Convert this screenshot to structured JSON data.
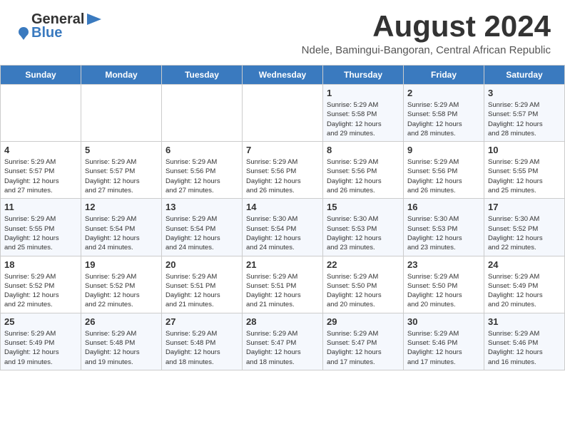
{
  "header": {
    "logo_general": "General",
    "logo_blue": "Blue",
    "month_title": "August 2024",
    "subtitle": "Ndele, Bamingui-Bangoran, Central African Republic"
  },
  "weekdays": [
    "Sunday",
    "Monday",
    "Tuesday",
    "Wednesday",
    "Thursday",
    "Friday",
    "Saturday"
  ],
  "weeks": [
    [
      {
        "day": "",
        "info": ""
      },
      {
        "day": "",
        "info": ""
      },
      {
        "day": "",
        "info": ""
      },
      {
        "day": "",
        "info": ""
      },
      {
        "day": "1",
        "info": "Sunrise: 5:29 AM\nSunset: 5:58 PM\nDaylight: 12 hours\nand 29 minutes."
      },
      {
        "day": "2",
        "info": "Sunrise: 5:29 AM\nSunset: 5:58 PM\nDaylight: 12 hours\nand 28 minutes."
      },
      {
        "day": "3",
        "info": "Sunrise: 5:29 AM\nSunset: 5:57 PM\nDaylight: 12 hours\nand 28 minutes."
      }
    ],
    [
      {
        "day": "4",
        "info": "Sunrise: 5:29 AM\nSunset: 5:57 PM\nDaylight: 12 hours\nand 27 minutes."
      },
      {
        "day": "5",
        "info": "Sunrise: 5:29 AM\nSunset: 5:57 PM\nDaylight: 12 hours\nand 27 minutes."
      },
      {
        "day": "6",
        "info": "Sunrise: 5:29 AM\nSunset: 5:56 PM\nDaylight: 12 hours\nand 27 minutes."
      },
      {
        "day": "7",
        "info": "Sunrise: 5:29 AM\nSunset: 5:56 PM\nDaylight: 12 hours\nand 26 minutes."
      },
      {
        "day": "8",
        "info": "Sunrise: 5:29 AM\nSunset: 5:56 PM\nDaylight: 12 hours\nand 26 minutes."
      },
      {
        "day": "9",
        "info": "Sunrise: 5:29 AM\nSunset: 5:56 PM\nDaylight: 12 hours\nand 26 minutes."
      },
      {
        "day": "10",
        "info": "Sunrise: 5:29 AM\nSunset: 5:55 PM\nDaylight: 12 hours\nand 25 minutes."
      }
    ],
    [
      {
        "day": "11",
        "info": "Sunrise: 5:29 AM\nSunset: 5:55 PM\nDaylight: 12 hours\nand 25 minutes."
      },
      {
        "day": "12",
        "info": "Sunrise: 5:29 AM\nSunset: 5:54 PM\nDaylight: 12 hours\nand 24 minutes."
      },
      {
        "day": "13",
        "info": "Sunrise: 5:29 AM\nSunset: 5:54 PM\nDaylight: 12 hours\nand 24 minutes."
      },
      {
        "day": "14",
        "info": "Sunrise: 5:30 AM\nSunset: 5:54 PM\nDaylight: 12 hours\nand 24 minutes."
      },
      {
        "day": "15",
        "info": "Sunrise: 5:30 AM\nSunset: 5:53 PM\nDaylight: 12 hours\nand 23 minutes."
      },
      {
        "day": "16",
        "info": "Sunrise: 5:30 AM\nSunset: 5:53 PM\nDaylight: 12 hours\nand 23 minutes."
      },
      {
        "day": "17",
        "info": "Sunrise: 5:30 AM\nSunset: 5:52 PM\nDaylight: 12 hours\nand 22 minutes."
      }
    ],
    [
      {
        "day": "18",
        "info": "Sunrise: 5:29 AM\nSunset: 5:52 PM\nDaylight: 12 hours\nand 22 minutes."
      },
      {
        "day": "19",
        "info": "Sunrise: 5:29 AM\nSunset: 5:52 PM\nDaylight: 12 hours\nand 22 minutes."
      },
      {
        "day": "20",
        "info": "Sunrise: 5:29 AM\nSunset: 5:51 PM\nDaylight: 12 hours\nand 21 minutes."
      },
      {
        "day": "21",
        "info": "Sunrise: 5:29 AM\nSunset: 5:51 PM\nDaylight: 12 hours\nand 21 minutes."
      },
      {
        "day": "22",
        "info": "Sunrise: 5:29 AM\nSunset: 5:50 PM\nDaylight: 12 hours\nand 20 minutes."
      },
      {
        "day": "23",
        "info": "Sunrise: 5:29 AM\nSunset: 5:50 PM\nDaylight: 12 hours\nand 20 minutes."
      },
      {
        "day": "24",
        "info": "Sunrise: 5:29 AM\nSunset: 5:49 PM\nDaylight: 12 hours\nand 20 minutes."
      }
    ],
    [
      {
        "day": "25",
        "info": "Sunrise: 5:29 AM\nSunset: 5:49 PM\nDaylight: 12 hours\nand 19 minutes."
      },
      {
        "day": "26",
        "info": "Sunrise: 5:29 AM\nSunset: 5:48 PM\nDaylight: 12 hours\nand 19 minutes."
      },
      {
        "day": "27",
        "info": "Sunrise: 5:29 AM\nSunset: 5:48 PM\nDaylight: 12 hours\nand 18 minutes."
      },
      {
        "day": "28",
        "info": "Sunrise: 5:29 AM\nSunset: 5:47 PM\nDaylight: 12 hours\nand 18 minutes."
      },
      {
        "day": "29",
        "info": "Sunrise: 5:29 AM\nSunset: 5:47 PM\nDaylight: 12 hours\nand 17 minutes."
      },
      {
        "day": "30",
        "info": "Sunrise: 5:29 AM\nSunset: 5:46 PM\nDaylight: 12 hours\nand 17 minutes."
      },
      {
        "day": "31",
        "info": "Sunrise: 5:29 AM\nSunset: 5:46 PM\nDaylight: 12 hours\nand 16 minutes."
      }
    ]
  ]
}
